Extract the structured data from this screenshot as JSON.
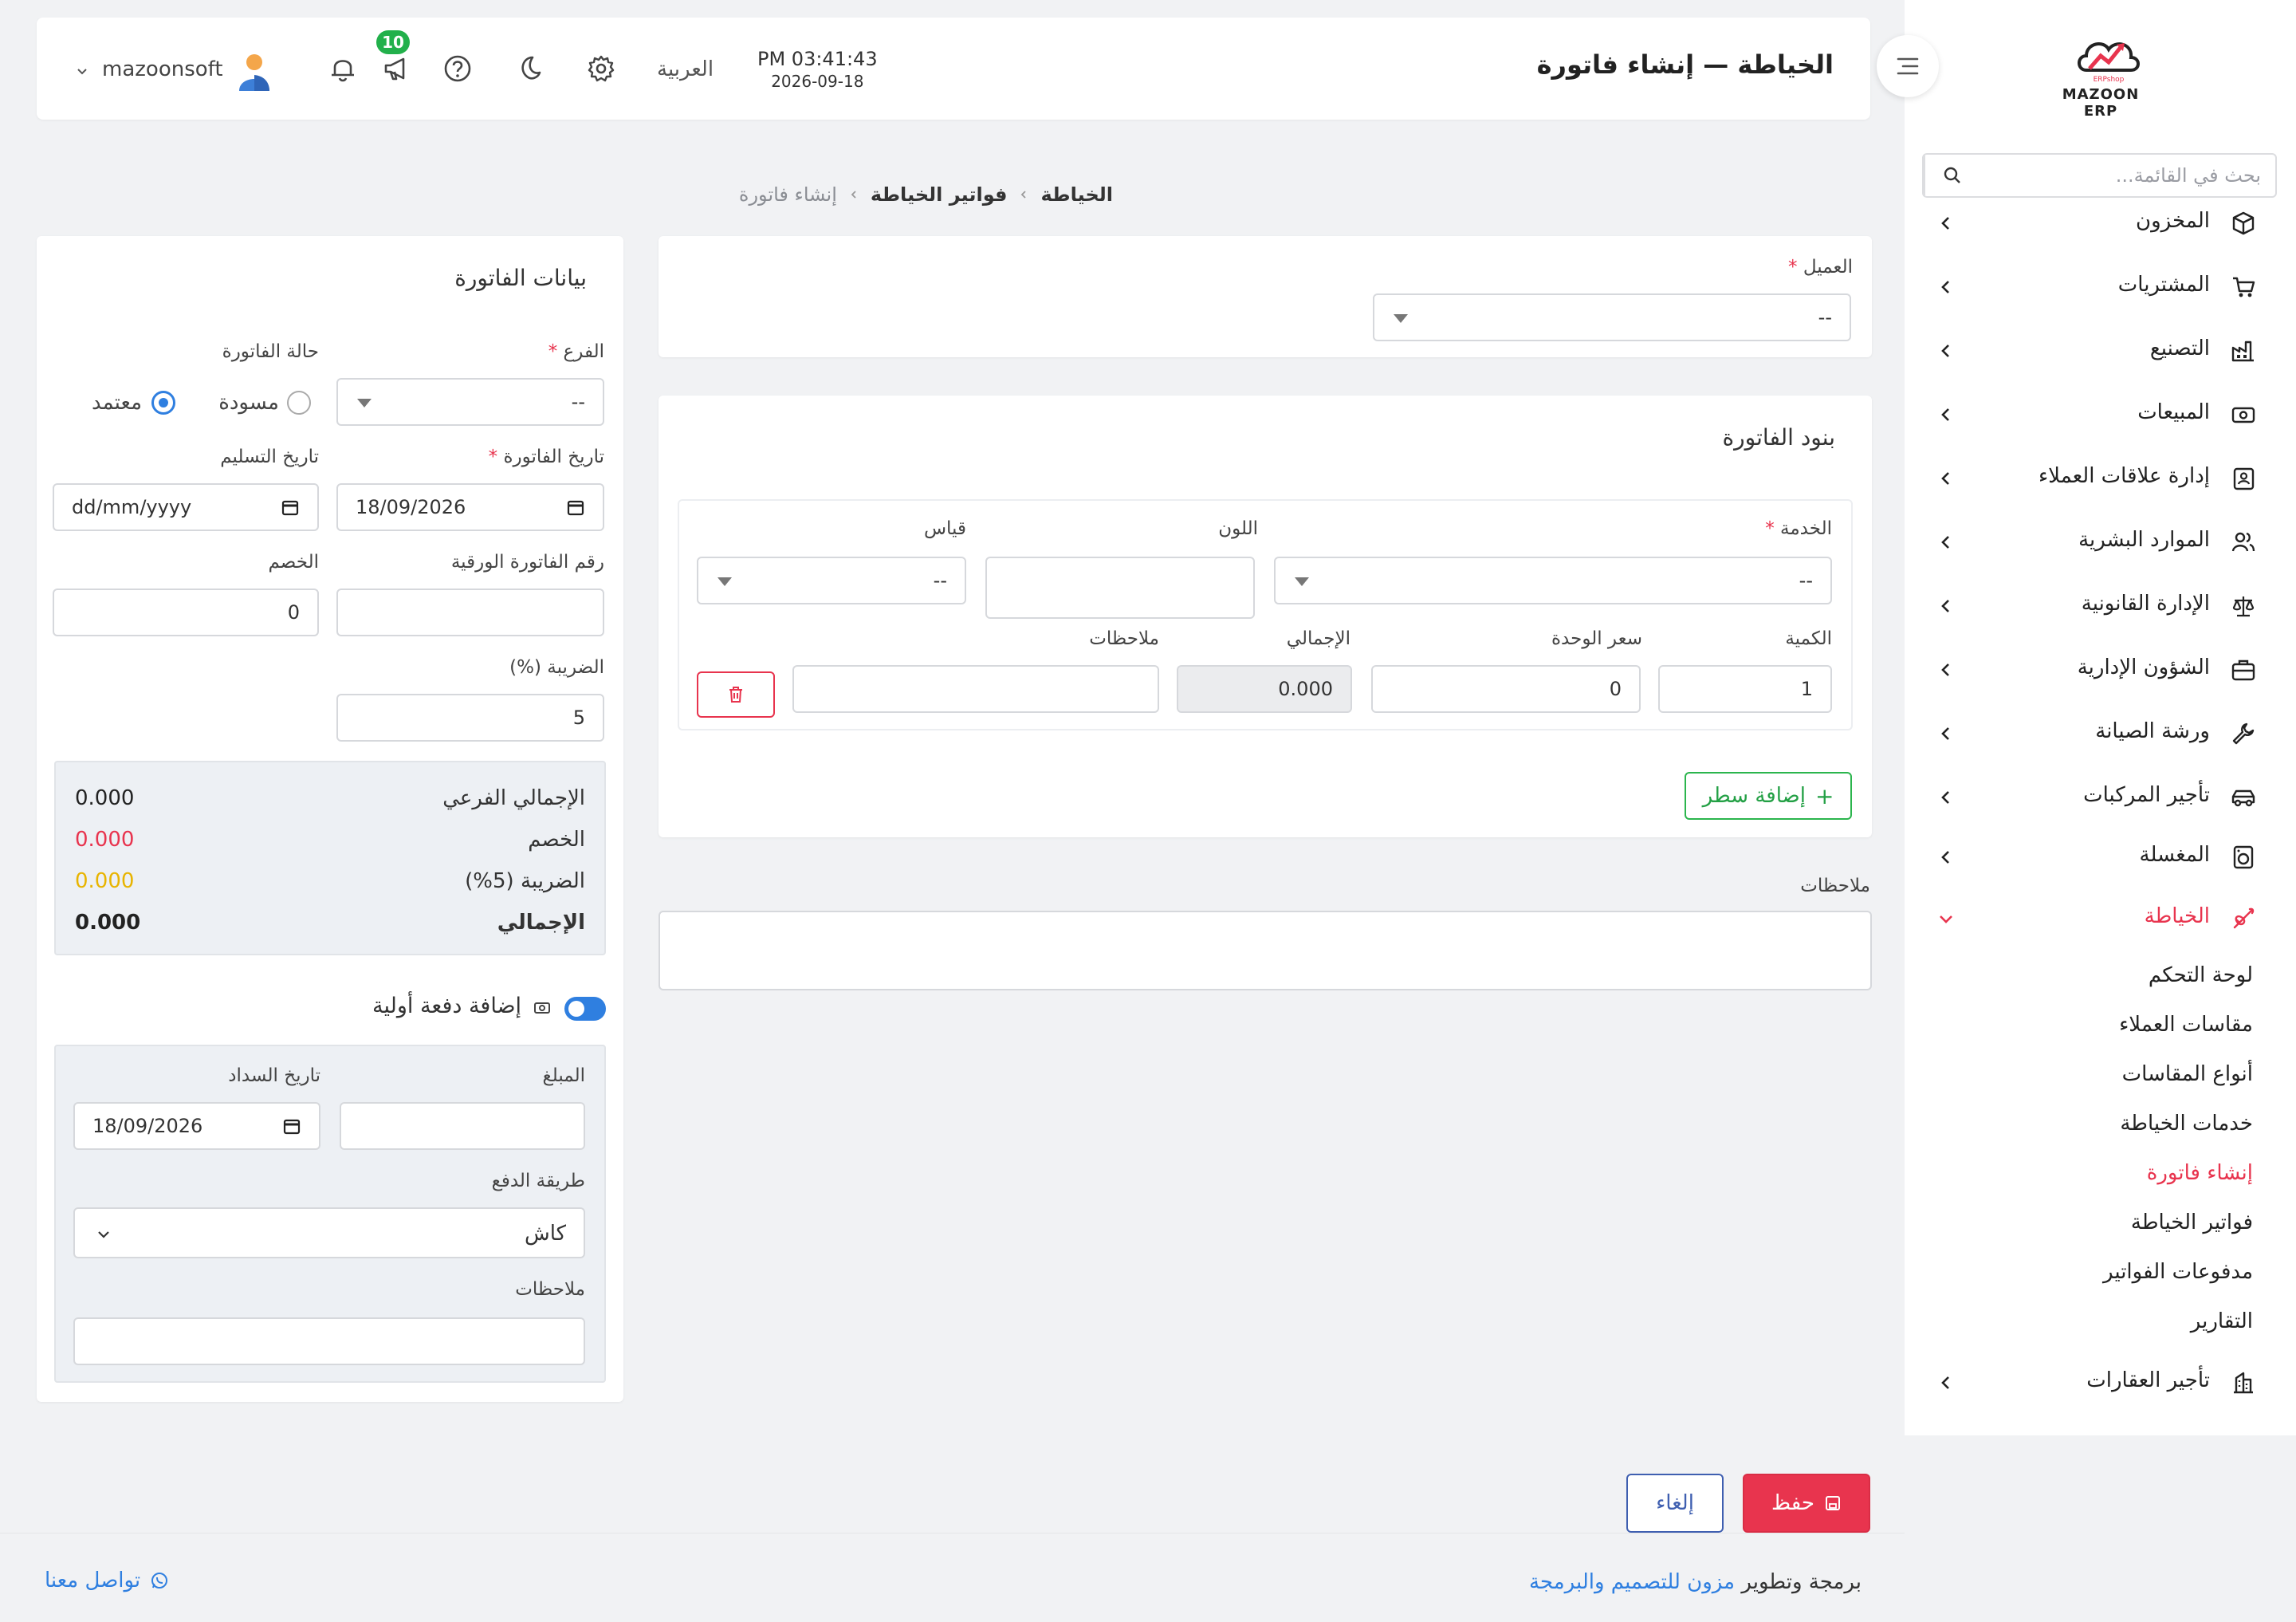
{
  "brand": {
    "logo_text": "MAZOON ERP",
    "logo_sub": "ERPshop"
  },
  "header": {
    "title": "الخياطة — إنشاء فاتورة",
    "time": "PM 03:41:43",
    "date": "2026-09-18",
    "language": "العربية",
    "notifications_count": "10",
    "username": "mazoonsoft"
  },
  "sidebar": {
    "search_placeholder": "بحث في القائمة...",
    "items": [
      {
        "label": "المخزون",
        "icon": "box-icon"
      },
      {
        "label": "المشتريات",
        "icon": "cart-icon"
      },
      {
        "label": "التصنيع",
        "icon": "factory-icon"
      },
      {
        "label": "المبيعات",
        "icon": "cash-icon"
      },
      {
        "label": "إدارة علاقات العملاء",
        "icon": "contacts-icon"
      },
      {
        "label": "الموارد البشرية",
        "icon": "users-icon"
      },
      {
        "label": "الإدارة القانونية",
        "icon": "scale-icon"
      },
      {
        "label": "الشؤون الإدارية",
        "icon": "briefcase-icon"
      },
      {
        "label": "ورشة الصيانة",
        "icon": "wrench-icon"
      },
      {
        "label": "تأجير المركبات",
        "icon": "car-icon"
      },
      {
        "label": "المغسلة",
        "icon": "laundry-icon"
      },
      {
        "label": "الخياطة",
        "icon": "needle-icon"
      },
      {
        "label": "تأجير العقارات",
        "icon": "building-icon"
      }
    ],
    "subitems": [
      {
        "label": "لوحة التحكم"
      },
      {
        "label": "مقاسات العملاء"
      },
      {
        "label": "أنواع المقاسات"
      },
      {
        "label": "خدمات الخياطة"
      },
      {
        "label": "إنشاء فاتورة"
      },
      {
        "label": "فواتير الخياطة"
      },
      {
        "label": "مدفوعات الفواتير"
      },
      {
        "label": "التقارير"
      }
    ]
  },
  "breadcrumb": {
    "root": "الخياطة",
    "parent": "فواتير الخياطة",
    "current": "إنشاء فاتورة"
  },
  "customer": {
    "label": "العميل",
    "value": "--",
    "required_mark": "*"
  },
  "items_section": {
    "title": "بنود الفاتورة",
    "service_label": "الخدمة",
    "service_value": "--",
    "color_label": "اللون",
    "color_value": "",
    "size_label": "قياس",
    "size_value": "--",
    "qty_label": "الكمية",
    "qty_value": "1",
    "unit_price_label": "سعر الوحدة",
    "unit_price_value": "0",
    "line_total_label": "الإجمالي",
    "line_total_value": "0.000",
    "line_notes_label": "ملاحظات",
    "line_notes_value": "",
    "add_row_label": "إضافة سطر"
  },
  "notes": {
    "label": "ملاحظات",
    "value": ""
  },
  "invoice_data": {
    "title": "بيانات الفاتورة",
    "branch_label": "الفرع",
    "branch_value": "--",
    "status_label": "حالة الفاتورة",
    "status_options": [
      "مسودة",
      "معتمد"
    ],
    "status_selected": "معتمد",
    "invoice_date_label": "تاريخ الفاتورة",
    "invoice_date_value": "18/09/2026",
    "delivery_date_label": "تاريخ التسليم",
    "delivery_date_value": "dd/mm/yyyy",
    "paper_no_label": "رقم الفاتورة الورقية",
    "paper_no_value": "",
    "discount_label": "الخصم",
    "discount_value": "0",
    "tax_label": "الضريبة (%)",
    "tax_value": "5"
  },
  "totals": {
    "subtotal_label": "الإجمالي الفرعي",
    "subtotal_value": "0.000",
    "discount_label": "الخصم",
    "discount_value": "0.000",
    "tax_label": "الضريبة (5%)",
    "tax_value": "0.000",
    "total_label": "الإجمالي",
    "total_value": "0.000"
  },
  "payment": {
    "toggle_label": "إضافة دفعة أولية",
    "toggle_on": true,
    "amount_label": "المبلغ",
    "amount_value": "",
    "pay_date_label": "تاريخ السداد",
    "pay_date_value": "18/09/2026",
    "method_label": "طريقة الدفع",
    "method_value": "كاش",
    "notes_label": "ملاحظات",
    "notes_value": ""
  },
  "actions": {
    "save_label": "حفظ",
    "cancel_label": "إلغاء"
  },
  "footer": {
    "credit_prefix": "برمجة وتطوير",
    "credit_link": "مزون للتصميم والبرمجة",
    "contact_label": "تواصل معنا"
  },
  "colors": {
    "accent": "#e8344e",
    "primary": "#2f7fe0",
    "success": "#2bb54d",
    "warning": "#e8b400"
  }
}
